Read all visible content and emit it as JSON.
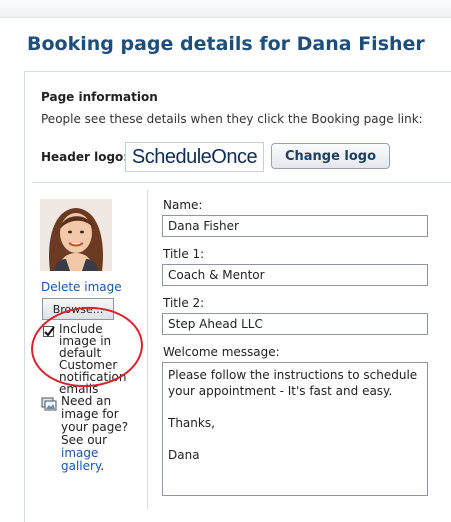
{
  "page": {
    "title": "Booking page details for Dana Fisher"
  },
  "page_information": {
    "heading": "Page information",
    "description": "People see these details when they click the Booking page link:",
    "header_logo_label": "Header logo:",
    "logo_text": "ScheduleOnce",
    "change_logo_label": "Change logo"
  },
  "image_panel": {
    "delete_image_label": "Delete image",
    "browse_label": "Browse...",
    "notify_checkbox_checked": true,
    "notify_label": "Include image in default Customer notification emails",
    "gallery_text_before": "Need an image for your page? See our",
    "gallery_link_label": "image gallery",
    "gallery_text_after": "."
  },
  "form": {
    "name_label": "Name:",
    "name_value": "Dana Fisher",
    "title1_label": "Title 1:",
    "title1_value": "Coach & Mentor",
    "title2_label": "Title 2:",
    "title2_value": "Step Ahead LLC",
    "welcome_label": "Welcome message:",
    "welcome_value": "Please follow the instructions to schedule your appointment - It's fast and easy.\n\nThanks,\n\nDana"
  },
  "colors": {
    "title": "#1e4e79",
    "link": "#1a56a8",
    "annotation_circle": "#d5242c"
  },
  "icons": {
    "gallery": "image-gallery-icon",
    "checkbox_check": "checkmark-icon"
  }
}
